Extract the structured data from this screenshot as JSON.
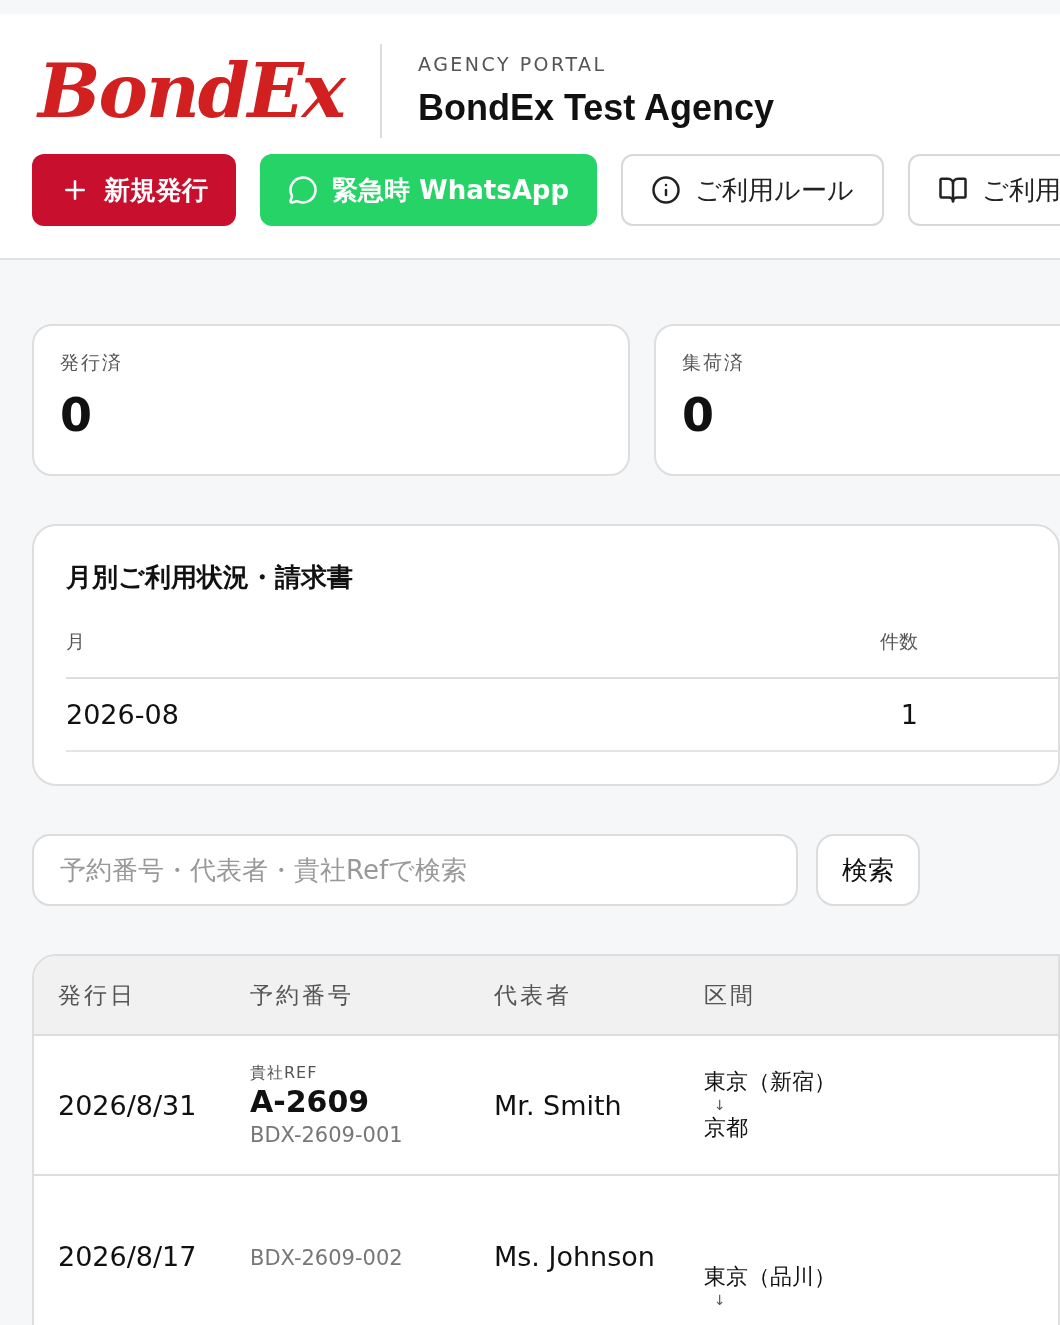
{
  "header": {
    "logo": "BondEx",
    "eyebrow": "AGENCY PORTAL",
    "agency_name": "BondEx Test Agency"
  },
  "actions": [
    {
      "kind": "create",
      "label": "新規発行"
    },
    {
      "kind": "whatsapp",
      "label": "緊急時 WhatsApp"
    },
    {
      "kind": "rules",
      "label": "ご利用ルール"
    },
    {
      "kind": "guide",
      "label": "ご利用"
    }
  ],
  "stats": [
    {
      "label": "発行済",
      "value": "0"
    },
    {
      "label": "集荷済",
      "value": "0"
    }
  ],
  "monthly": {
    "title": "月別ご利用状況・請求書",
    "columns": [
      "月",
      "件数"
    ],
    "rows": [
      {
        "month": "2026-08",
        "count": "1"
      }
    ]
  },
  "search": {
    "placeholder": "予約番号・代表者・貴社Refで検索",
    "button": "検索"
  },
  "table": {
    "columns": [
      "発行日",
      "予約番号",
      "代表者",
      "区間"
    ],
    "rows": [
      {
        "date": "2026/8/31",
        "ref_label": "貴社REF",
        "ref": "A-2609",
        "booking": "BDX-2609-001",
        "rep": "Mr. Smith",
        "from": "東京（新宿）",
        "arrow": "↓",
        "to": "京都"
      },
      {
        "date": "2026/8/17",
        "booking": "BDX-2609-002",
        "rep": "Ms. Johnson",
        "from": "東京（品川）",
        "arrow": "↓"
      }
    ]
  }
}
